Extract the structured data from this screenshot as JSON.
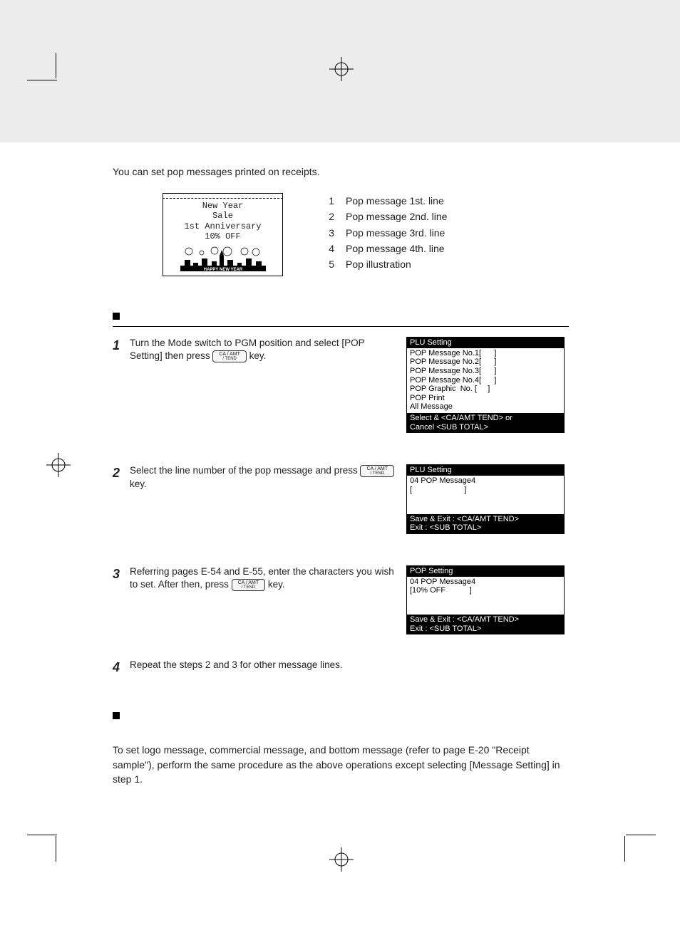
{
  "intro": "You can set pop messages printed on receipts.",
  "receipt": {
    "line1": "New Year",
    "line2": "Sale",
    "line3": "1st Anniversary",
    "line4": "10% OFF",
    "banner": "HAPPY NEW YEAR"
  },
  "legend": [
    {
      "n": "1",
      "label": "Pop message 1st. line"
    },
    {
      "n": "2",
      "label": "Pop message 2nd. line"
    },
    {
      "n": "3",
      "label": "Pop message 3rd. line"
    },
    {
      "n": "4",
      "label": "Pop message 4th. line"
    },
    {
      "n": "5",
      "label": "Pop illustration"
    }
  ],
  "keycap": {
    "top": "CA / AMT",
    "bottom": "/ TEND"
  },
  "step1": {
    "num": "1",
    "text_a": "Turn the Mode switch to PGM position and select [POP Setting] then press ",
    "text_b": " key."
  },
  "step2": {
    "num": "2",
    "text_a": "Select the line number of the pop message and press ",
    "text_b": " key."
  },
  "step3": {
    "num": "3",
    "text_a": "Referring pages E-54 and E-55, enter the characters you wish to set. After then, press ",
    "text_b": " key."
  },
  "step4": {
    "num": "4",
    "text": "Repeat the steps 2 and 3 for other message lines."
  },
  "lcd1": {
    "head": "PLU Setting",
    "body": "POP Message No.1[      ]\nPOP Message No.2[      ]\nPOP Message No.3[      ]\nPOP Message No.4[      ]\nPOP Graphic  No. [     ]\nPOP Print\nAll Message",
    "foot": "Select & <CA/AMT TEND> or\nCancel <SUB TOTAL>"
  },
  "lcd2": {
    "head": "PLU Setting",
    "body": "04 POP Message4\n[                        ]\n\n\n",
    "foot": "Save & Exit : <CA/AMT TEND>\nExit : <SUB TOTAL>"
  },
  "lcd3": {
    "head": "POP Setting",
    "body": "04 POP Message4\n[10% OFF           ]\n\n\n",
    "foot": "Save & Exit : <CA/AMT TEND>\nExit : <SUB TOTAL>"
  },
  "final_para": "To set logo message, commercial message, and bottom message (refer to page E-20 \"Receipt sample\"), perform the same procedure as the above operations except selecting [Message Setting] in step 1."
}
